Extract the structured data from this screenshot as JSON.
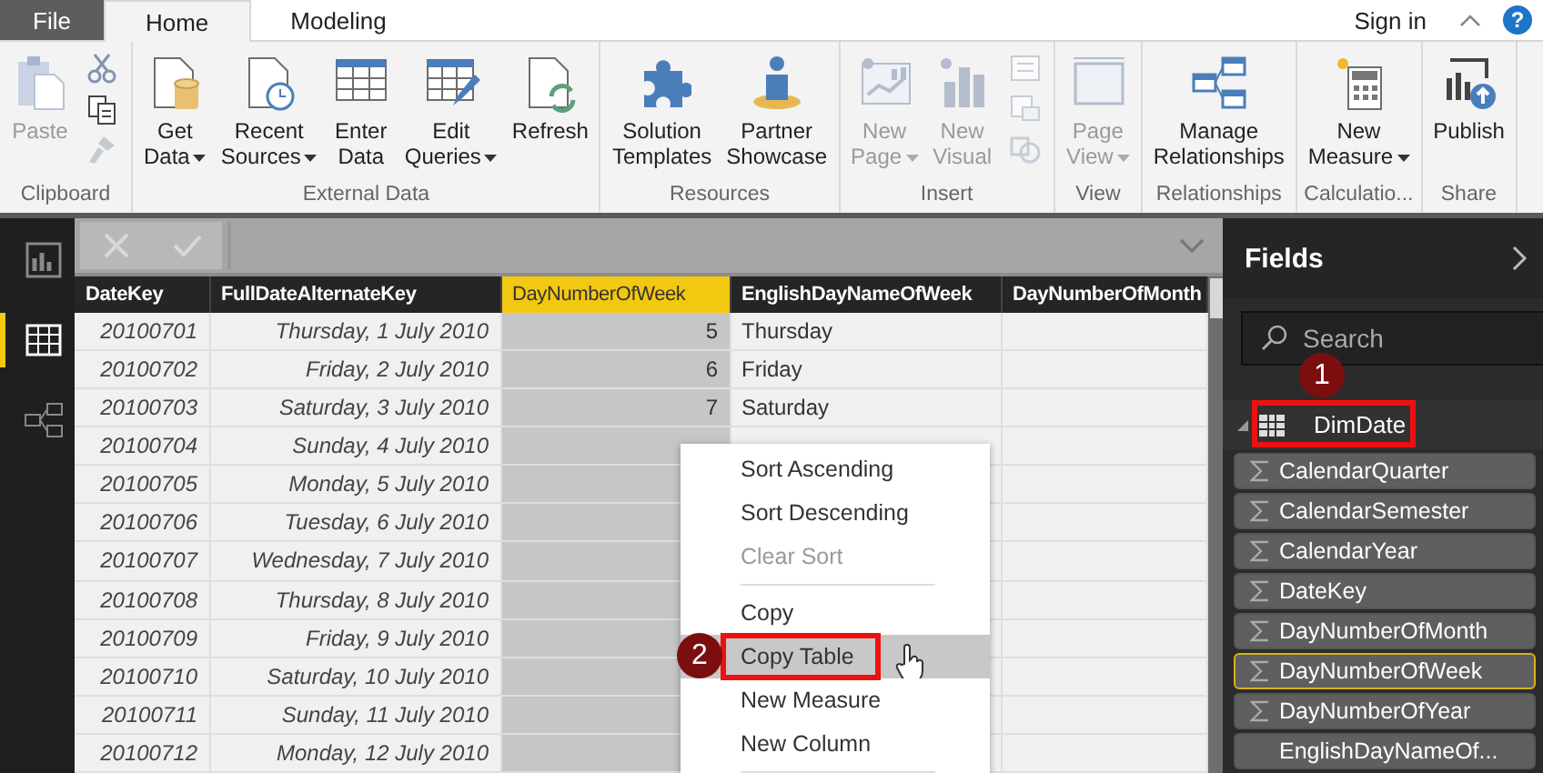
{
  "tabs": [
    {
      "label": "File",
      "kind": "file",
      "selected": false
    },
    {
      "label": "Home",
      "kind": "tab",
      "selected": true
    },
    {
      "label": "Modeling",
      "kind": "tab",
      "selected": false
    }
  ],
  "account": {
    "sign_in": "Sign in",
    "help": "?"
  },
  "ribbon": [
    {
      "name": "Clipboard",
      "buttons": [
        {
          "label": "Paste",
          "disabled": true,
          "dropdown": false
        }
      ],
      "small_tools": [
        {
          "disabled": false
        },
        {
          "disabled": false
        },
        {
          "disabled": true
        }
      ]
    },
    {
      "name": "External Data",
      "buttons": [
        {
          "label": "Get\nData",
          "disabled": false,
          "dropdown": true
        },
        {
          "label": "Recent\nSources",
          "disabled": false,
          "dropdown": true
        },
        {
          "label": "Enter\nData",
          "disabled": false,
          "dropdown": false
        },
        {
          "label": "Edit\nQueries",
          "disabled": false,
          "dropdown": true
        },
        {
          "label": "Refresh",
          "disabled": false,
          "dropdown": false
        }
      ]
    },
    {
      "name": "Resources",
      "buttons": [
        {
          "label": "Solution\nTemplates",
          "disabled": false,
          "dropdown": false
        },
        {
          "label": "Partner\nShowcase",
          "disabled": false,
          "dropdown": false
        }
      ]
    },
    {
      "name": "Insert",
      "buttons": [
        {
          "label": "New\nPage",
          "disabled": true,
          "dropdown": true
        },
        {
          "label": "New\nVisual",
          "disabled": true,
          "dropdown": false
        }
      ],
      "small_tools": [
        {
          "disabled": true
        },
        {
          "disabled": true
        },
        {
          "disabled": true
        }
      ]
    },
    {
      "name": "View",
      "buttons": [
        {
          "label": "Page\nView",
          "disabled": true,
          "dropdown": true
        }
      ]
    },
    {
      "name": "Relationships",
      "buttons": [
        {
          "label": "Manage\nRelationships",
          "disabled": false,
          "dropdown": false
        }
      ]
    },
    {
      "name": "Calculatio...",
      "buttons": [
        {
          "label": "New\nMeasure",
          "disabled": false,
          "dropdown": true
        }
      ]
    },
    {
      "name": "Share",
      "buttons": [
        {
          "label": "Publish",
          "disabled": false,
          "dropdown": false
        }
      ]
    }
  ],
  "views": [
    {
      "selected": false
    },
    {
      "selected": true
    },
    {
      "selected": false
    }
  ],
  "table": {
    "columns": [
      {
        "title": "DateKey",
        "selected": false
      },
      {
        "title": "FullDateAlternateKey",
        "selected": false
      },
      {
        "title": "DayNumberOfWeek",
        "selected": true
      },
      {
        "title": "EnglishDayNameOfWeek",
        "selected": false
      },
      {
        "title": "DayNumberOfMonth",
        "selected": false
      }
    ],
    "rows": [
      {
        "date_key": "20100701",
        "full_date": "Thursday, 1 July 2010",
        "day_number": "5",
        "day_name": "Thursday"
      },
      {
        "date_key": "20100702",
        "full_date": "Friday, 2 July 2010",
        "day_number": "6",
        "day_name": "Friday"
      },
      {
        "date_key": "20100703",
        "full_date": "Saturday, 3 July 2010",
        "day_number": "7",
        "day_name": "Saturday"
      },
      {
        "date_key": "20100704",
        "full_date": "Sunday, 4 July 2010"
      },
      {
        "date_key": "20100705",
        "full_date": "Monday, 5 July 2010"
      },
      {
        "date_key": "20100706",
        "full_date": "Tuesday, 6 July 2010"
      },
      {
        "date_key": "20100707",
        "full_date": "Wednesday, 7 July 2010"
      },
      {
        "date_key": "20100708",
        "full_date": "Thursday, 8 July 2010"
      },
      {
        "date_key": "20100709",
        "full_date": "Friday, 9 July 2010"
      },
      {
        "date_key": "20100710",
        "full_date": "Saturday, 10 July 2010"
      },
      {
        "date_key": "20100711",
        "full_date": "Sunday, 11 July 2010"
      },
      {
        "date_key": "20100712",
        "full_date": "Monday, 12 July 2010"
      }
    ]
  },
  "context_menu": {
    "items": [
      {
        "kind": "item",
        "label": "Sort Ascending",
        "disabled": false,
        "selected": false
      },
      {
        "kind": "item",
        "label": "Sort Descending",
        "disabled": false,
        "selected": false
      },
      {
        "kind": "item",
        "label": "Clear Sort",
        "disabled": true,
        "selected": false
      },
      {
        "kind": "separator"
      },
      {
        "kind": "item",
        "label": "Copy",
        "disabled": false,
        "selected": false
      },
      {
        "kind": "item",
        "label": "Copy Table",
        "disabled": false,
        "selected": true,
        "annotation": "2"
      },
      {
        "kind": "item",
        "label": "New Measure",
        "disabled": false,
        "selected": false
      },
      {
        "kind": "item",
        "label": "New Column",
        "disabled": false,
        "selected": false
      },
      {
        "kind": "separator"
      }
    ]
  },
  "fields": {
    "title": "Fields",
    "search": {
      "placeholder": "Search"
    },
    "table": {
      "name": "DimDate",
      "expanded": true,
      "annotation": "1"
    },
    "items": [
      {
        "name": "CalendarQuarter",
        "kind": "numeric",
        "selected": false
      },
      {
        "name": "CalendarSemester",
        "kind": "numeric",
        "selected": false
      },
      {
        "name": "CalendarYear",
        "kind": "numeric",
        "selected": false
      },
      {
        "name": "DateKey",
        "kind": "numeric",
        "selected": false
      },
      {
        "name": "DayNumberOfMonth",
        "kind": "numeric",
        "selected": false
      },
      {
        "name": "DayNumberOfWeek",
        "kind": "numeric",
        "selected": true
      },
      {
        "name": "DayNumberOfYear",
        "kind": "numeric",
        "selected": false
      },
      {
        "name": "EnglishDayNameOf...",
        "kind": "text",
        "selected": false
      }
    ]
  }
}
